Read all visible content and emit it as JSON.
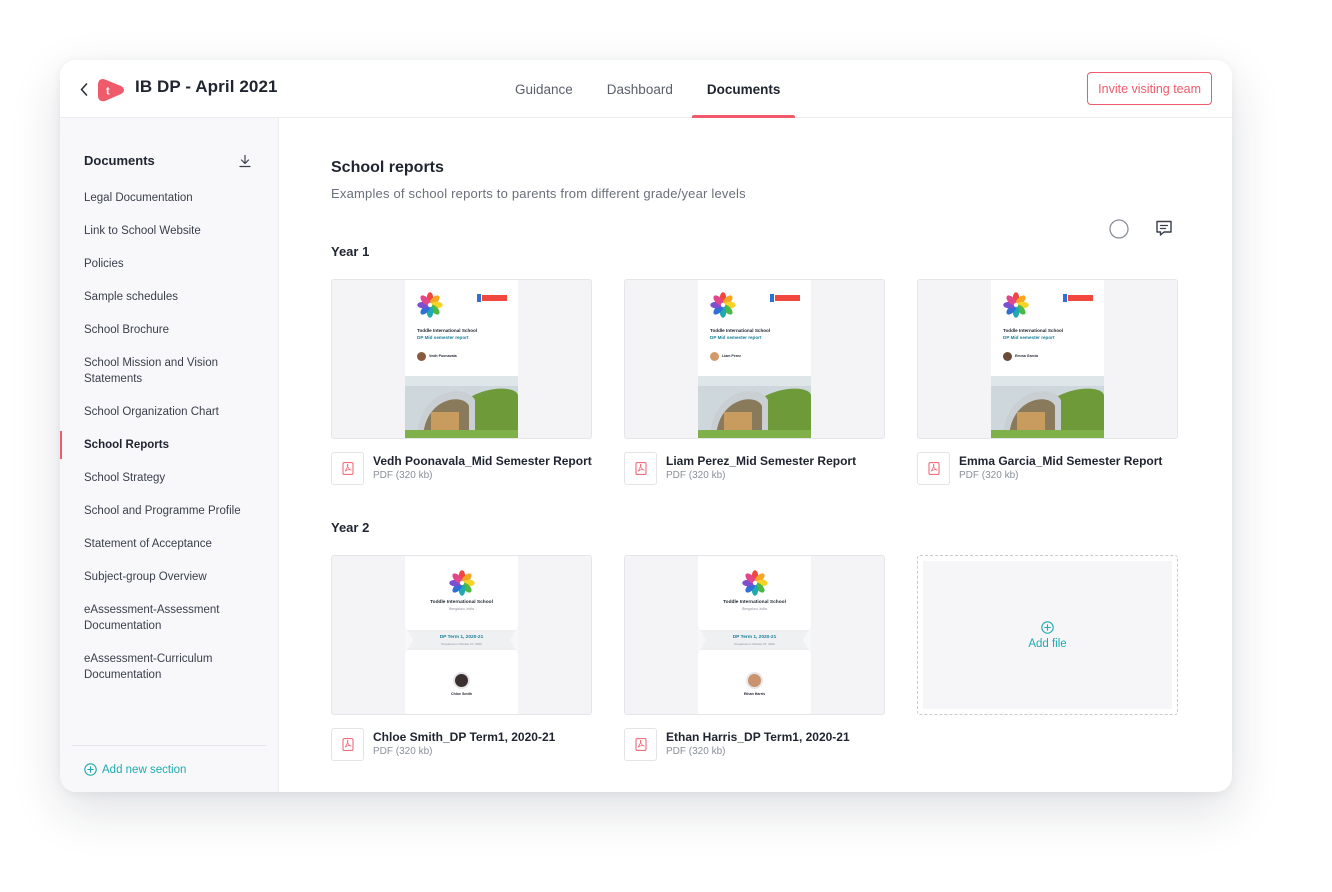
{
  "header": {
    "title": "IB DP - April 2021",
    "logo_letter": "t",
    "tabs": [
      {
        "label": "Guidance"
      },
      {
        "label": "Dashboard"
      },
      {
        "label": "Documents"
      }
    ],
    "invite_label": "Invite visiting team"
  },
  "sidebar": {
    "title": "Documents",
    "items": [
      {
        "label": "Legal Documentation"
      },
      {
        "label": "Link to School Website"
      },
      {
        "label": "Policies"
      },
      {
        "label": "Sample schedules"
      },
      {
        "label": "School Brochure"
      },
      {
        "label": "School Mission and Vision Statements"
      },
      {
        "label": "School Organization Chart"
      },
      {
        "label": "School Reports"
      },
      {
        "label": "School Strategy"
      },
      {
        "label": "School and Programme Profile"
      },
      {
        "label": "Statement of Acceptance"
      },
      {
        "label": "Subject-group Overview"
      },
      {
        "label": "eAssessment-Assessment Documentation"
      },
      {
        "label": "eAssessment-Curriculum Documentation"
      }
    ],
    "add_section_label": "Add new section"
  },
  "main": {
    "title": "School reports",
    "description": "Examples of school reports to parents from different grade/year levels",
    "groups": [
      {
        "label": "Year 1",
        "files": [
          {
            "name": "Vedh Poonavala_Mid Semester Report",
            "size": "PDF (320 kb)",
            "school": "Toddle International School",
            "report": "DP Mid semester report",
            "student": "Vedh Poonavala"
          },
          {
            "name": "Liam Perez_Mid Semester Report",
            "size": "PDF (320 kb)",
            "school": "Toddle International School",
            "report": "DP Mid semester report",
            "student": "Liam Perez"
          },
          {
            "name": "Emma Garcia_Mid Semester Report",
            "size": "PDF (320 kb)",
            "school": "Toddle International School",
            "report": "DP Mid semester report",
            "student": "Emma Garcia"
          }
        ]
      },
      {
        "label": "Year 2",
        "files": [
          {
            "name": "Chloe Smith_DP Term1, 2020-21",
            "size": "PDF (320 kb)",
            "school": "Toddle International School",
            "city": "Bengaluru, India",
            "term": "DP Term 1, 2020-21",
            "prepared": "Prepared on October 27, 2020",
            "student": "Chloe Smith"
          },
          {
            "name": "Ethan Harris_DP Term1, 2020-21",
            "size": "PDF (320 kb)",
            "school": "Toddle International School",
            "city": "Bengaluru, India",
            "term": "DP Term 1, 2020-21",
            "prepared": "Prepared on October 27, 2020",
            "student": "Ethan Harris"
          }
        ]
      }
    ],
    "add_file_label": "Add file"
  },
  "colors": {
    "accent": "#ef5b6b",
    "teal": "#1eaab0",
    "sidebar_bg": "#f8f8fa"
  },
  "icons": [
    "back-arrow-icon",
    "toddle-logo-icon",
    "download-icon",
    "status-circle-icon",
    "comment-icon",
    "pdf-icon",
    "add-circle-icon"
  ]
}
